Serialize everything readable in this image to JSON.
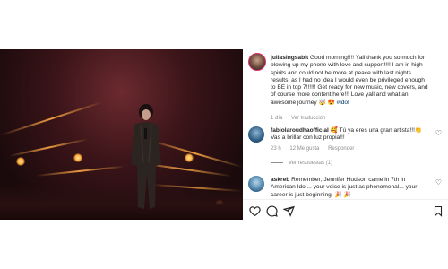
{
  "comments": [
    {
      "username": "juliasingsabit",
      "text": "Good morning!!!! Yall thank you so much for blowing up my phone with love and support!!!! I am in high spirits and could not be more at peace with last nights results, as I had no idea I would even be privileged enough to BE in top 7!!!!!! Get ready for new music, new covers, and of course more content here!!! Love yall and what an awesome journey 🤯 😍",
      "hashtag": "#idol",
      "time": "1 día",
      "action": "Ver traducción"
    },
    {
      "username": "fabiolaroudhaofficial",
      "text": "🥰 Tú ya eres una gran artista!!!👏 Vas a brillar con luz propia!!!",
      "time": "23 h",
      "likes": "12 Me gusta",
      "reply": "Responder",
      "view_replies": "Ver respuestas (1)"
    },
    {
      "username": "askreb",
      "text": "Remember; Jennifer Hudson came in 7th in American Idol... your voice is just as phenomenal... your career is just beginning! 🎉 🎉"
    }
  ],
  "icons": {
    "like": "heart-icon",
    "comment": "comment-icon",
    "share": "share-icon",
    "save": "bookmark-icon"
  },
  "colors": {
    "hashtag": "#00376b",
    "meta": "#8e8e8e"
  }
}
